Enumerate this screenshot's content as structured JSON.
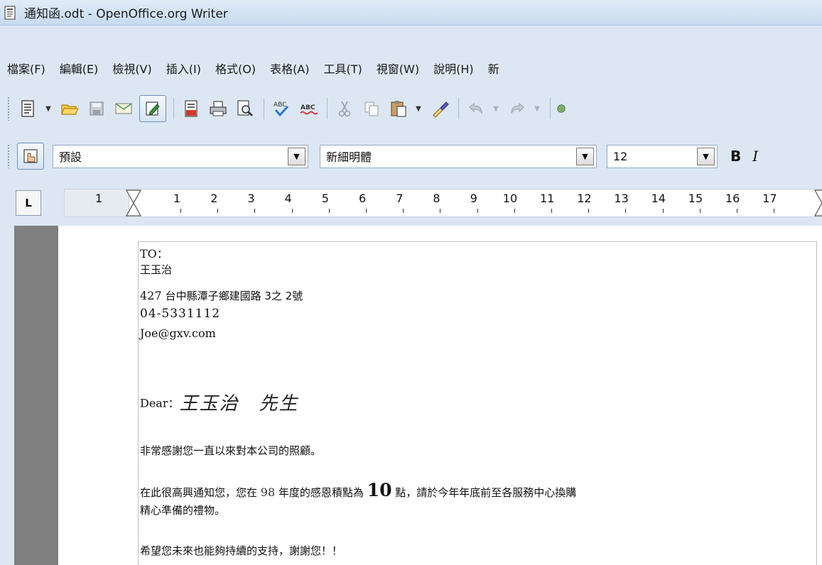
{
  "window": {
    "title": "通知函.odt - OpenOffice.org Writer",
    "app_icon": "writer-document-icon"
  },
  "menubar": {
    "items": [
      {
        "label": "檔案(F)"
      },
      {
        "label": "編輯(E)"
      },
      {
        "label": "檢視(V)"
      },
      {
        "label": "插入(I)"
      },
      {
        "label": "格式(O)"
      },
      {
        "label": "表格(A)"
      },
      {
        "label": "工具(T)"
      },
      {
        "label": "視窗(W)"
      },
      {
        "label": "說明(H)"
      },
      {
        "label": "新"
      }
    ]
  },
  "toolbar": {
    "icons": [
      "new-document-icon",
      "open-folder-icon",
      "save-icon",
      "email-icon",
      "edit-file-icon",
      "export-pdf-icon",
      "print-icon",
      "print-preview-icon",
      "spellcheck-icon",
      "autospellcheck-icon",
      "cut-icon",
      "copy-icon",
      "paste-icon",
      "clone-formatting-icon",
      "undo-icon",
      "redo-icon"
    ]
  },
  "formatting": {
    "paragraph_style": "預設",
    "font_name": "新細明體",
    "font_size": "12",
    "bold_label": "B",
    "italic_label": "I"
  },
  "ruler": {
    "tab_type_label": "L",
    "left_number": "1",
    "numbers": [
      "1",
      "2",
      "3",
      "4",
      "5",
      "6",
      "7",
      "8",
      "9",
      "10",
      "11",
      "12",
      "13",
      "14",
      "15",
      "16",
      "17"
    ]
  },
  "document": {
    "to_label": "TO：",
    "recipient_name": "王玉治",
    "address_zip": "427 ",
    "address": "台中縣潭子鄉建國路 3之 2號",
    "phone": "04-5331112",
    "email": "Joe@gxv.com",
    "dear_label": "Dear：",
    "dear_name": "王玉治　先生",
    "para1": "非常感謝您一直以來對本公司的照顧。",
    "para2_before": "在此很高興通知您，您在 ",
    "para2_year": "98",
    "para2_mid": " 年度的感恩積點為 ",
    "para2_points": "10",
    "para2_after": " 點，請於今年年底前至各服務中心換購",
    "para2_line2": "精心準備的禮物。",
    "para3": "希望您未來也能夠持續的支持，謝謝您！！"
  }
}
